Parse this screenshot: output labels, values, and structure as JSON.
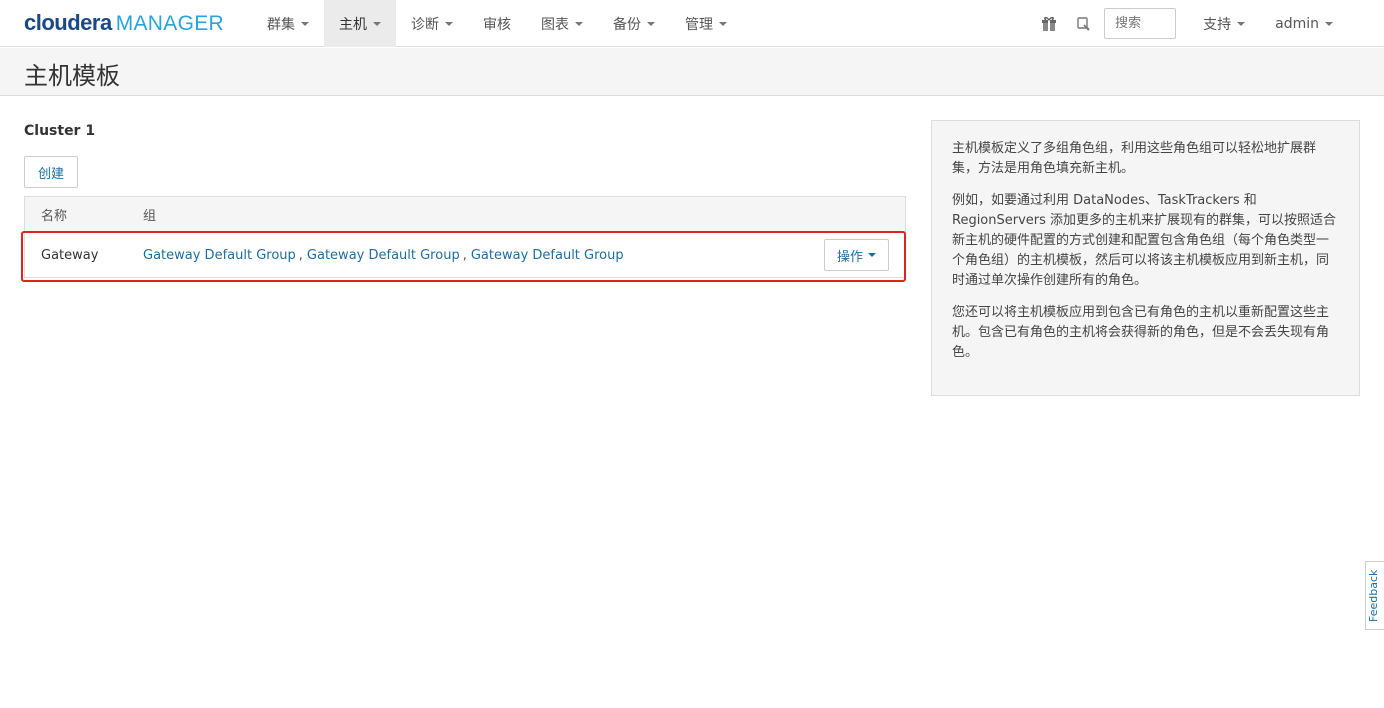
{
  "brand": {
    "name": "cloudera",
    "product": "MANAGER"
  },
  "nav": {
    "items": [
      {
        "label": "群集",
        "dropdown": true,
        "active": false
      },
      {
        "label": "主机",
        "dropdown": true,
        "active": true
      },
      {
        "label": "诊断",
        "dropdown": true,
        "active": false
      },
      {
        "label": "审核",
        "dropdown": false,
        "active": false
      },
      {
        "label": "图表",
        "dropdown": true,
        "active": false
      },
      {
        "label": "备份",
        "dropdown": true,
        "active": false
      },
      {
        "label": "管理",
        "dropdown": true,
        "active": false
      }
    ],
    "icons": [
      "gift-icon",
      "alerts-icon"
    ],
    "search_placeholder": "搜索",
    "support_label": "支持",
    "user_label": "admin"
  },
  "page": {
    "title": "主机模板"
  },
  "cluster": {
    "title": "Cluster 1",
    "create_label": "创建",
    "table": {
      "headers": {
        "name": "名称",
        "group": "组"
      },
      "rows": [
        {
          "name": "Gateway",
          "groups": [
            "Gateway Default Group",
            "Gateway Default Group",
            "Gateway Default Group"
          ],
          "separator": ",",
          "action_label": "操作"
        }
      ]
    }
  },
  "help": {
    "paragraphs": [
      "主机模板定义了多组角色组，利用这些角色组可以轻松地扩展群集，方法是用角色填充新主机。",
      "例如，如要通过利用 DataNodes、TaskTrackers 和 RegionServers 添加更多的主机来扩展现有的群集，可以按照适合新主机的硬件配置的方式创建和配置包含角色组（每个角色类型一个角色组）的主机模板，然后可以将该主机模板应用到新主机，同时通过单次操作创建所有的角色。",
      "您还可以将主机模板应用到包含已有角色的主机以重新配置这些主机。包含已有角色的主机将会获得新的角色，但是不会丢失现有角色。"
    ]
  },
  "feedback_label": "Feedback",
  "colors": {
    "link": "#1e6da0",
    "highlight": "#e0241b",
    "brand_dark": "#1a4a86",
    "brand_light": "#2aa3dd"
  }
}
